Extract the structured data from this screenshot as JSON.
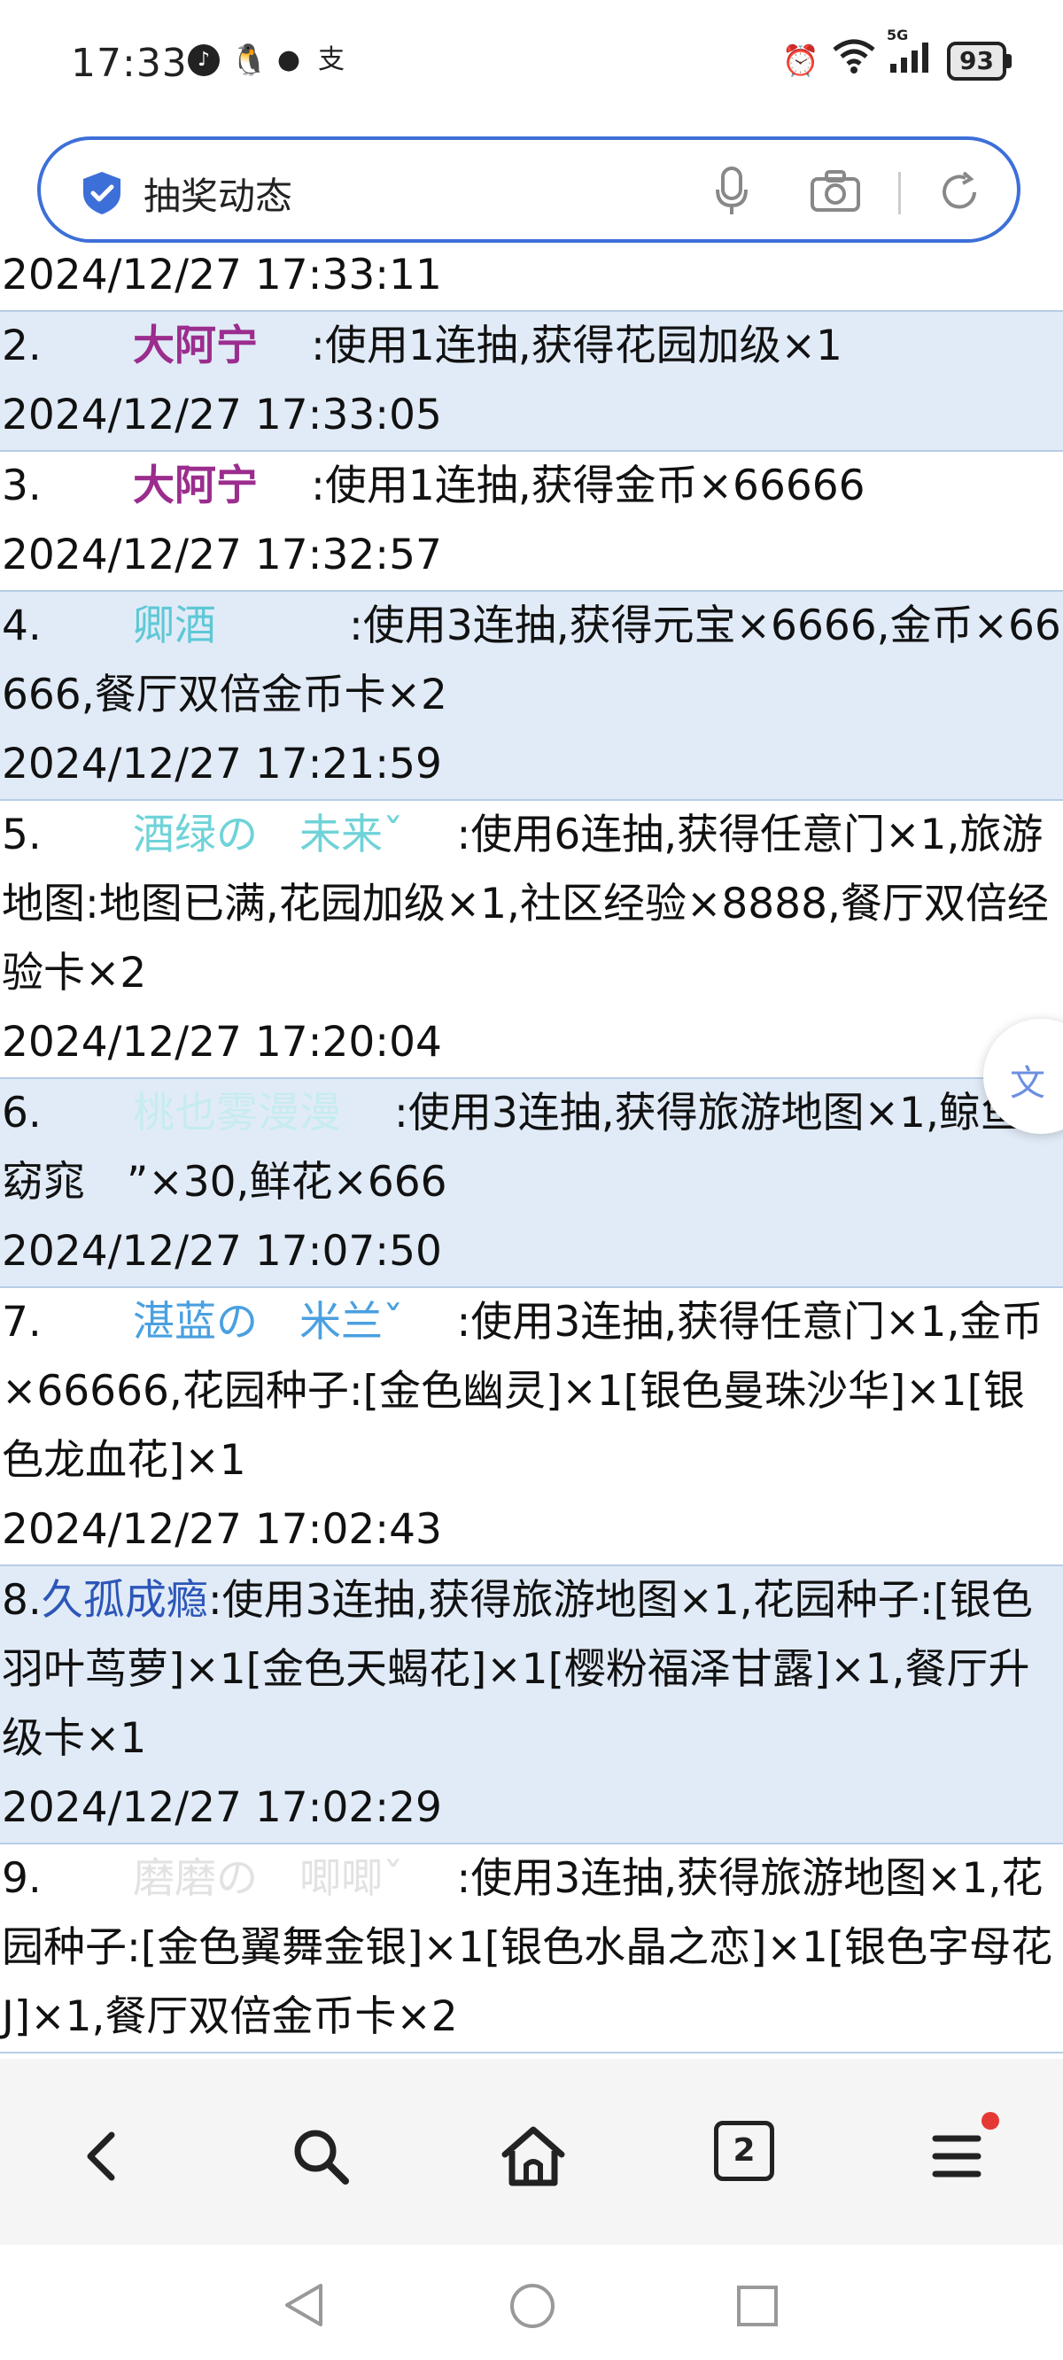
{
  "status": {
    "time": "17:33",
    "app_icons": [
      "tiktok-icon",
      "qq-icon",
      "wechat-icon",
      "alipay-icon"
    ],
    "network": "5G",
    "battery": "93"
  },
  "search": {
    "query": "抽奖动态"
  },
  "first_timestamp": "2024/12/27 17:33:11",
  "entries": [
    {
      "num": "2.",
      "user": "大阿宁",
      "user_color": "#9b2d8e",
      "text": ":使用1连抽,获得花园加级×1",
      "time": "2024/12/27 17:33:05"
    },
    {
      "num": "3.",
      "user": "大阿宁",
      "user_color": "#9b2d8e",
      "text": ":使用1连抽,获得金币×66666",
      "time": "2024/12/27 17:32:57"
    },
    {
      "num": "4.",
      "user": "卿酒",
      "user_color": "#5ec8d6",
      "text": ":使用3连抽,获得元宝×6666,金币×66666,餐厅双倍金币卡×2",
      "time": "2024/12/27 17:21:59"
    },
    {
      "num": "5.",
      "user": "酒绿の　未来ˇ",
      "user_color": "#6fd3d8",
      "text": ":使用6连抽,获得任意门×1,旅游地图:地图已满,花园加级×1,社区经验×8888,餐厅双倍经验卡×2",
      "time": "2024/12/27 17:20:04"
    },
    {
      "num": "6.",
      "user": "桃也雾漫漫",
      "user_color": "#c6ecf0",
      "text": ":使用3连抽,获得旅游地图×1,鲸鱼”　窈窕　”×30,鲜花×666",
      "time": "2024/12/27 17:07:50"
    },
    {
      "num": "7.",
      "user": "湛蓝の　米兰ˇ",
      "user_color": "#4aa0e0",
      "text": ":使用3连抽,获得任意门×1,金币×66666,花园种子:[金色幽灵]×1[银色曼珠沙华]×1[银色龙血花]×1",
      "time": "2024/12/27 17:02:43"
    },
    {
      "num": "8.",
      "user": "久孤成瘾",
      "user_color": "#2c56b8",
      "text": ":使用3连抽,获得旅游地图×1,花园种子:[银色羽叶茑萝]×1[金色天蝎花]×1[樱粉福泽甘露]×1,餐厅升级卡×1",
      "time": "2024/12/27 17:02:29"
    },
    {
      "num": "9.",
      "user": "磨磨の　唧唧ˇ",
      "user_color": "#e2e2e2",
      "text": ":使用3连抽,获得旅游地图×1,花园种子:[金色翼舞金银]×1[银色水晶之恋]×1[银色字母花J]×1,餐厅双倍金币卡×2",
      "time": ""
    }
  ],
  "translate_fab": "文",
  "toolbar": {
    "tab_count": "2"
  }
}
